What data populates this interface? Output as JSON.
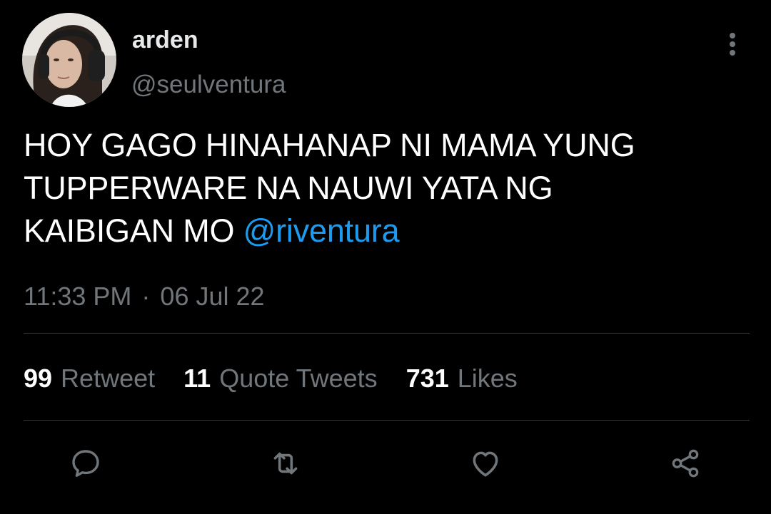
{
  "user": {
    "display_name": "arden",
    "handle": "@seulventura"
  },
  "tweet": {
    "line1": "HOY GAGO HINAHANAP NI MAMA YUNG",
    "line2": "TUPPERWARE NA NAUWI YATA NG",
    "line3_prefix": "KAIBIGAN MO ",
    "mention": "@riventura",
    "time": "11:33 PM",
    "separator": "·",
    "date": "06 Jul 22"
  },
  "stats": {
    "retweet_count": "99",
    "retweet_label": "Retweet",
    "quote_count": "11",
    "quote_label": "Quote Tweets",
    "like_count": "731",
    "like_label": "Likes"
  },
  "icons": {
    "more": "more-vertical-icon",
    "reply": "reply-icon",
    "retweet": "retweet-icon",
    "like": "heart-icon",
    "share": "share-icon"
  },
  "colors": {
    "background": "#000000",
    "text": "#ffffff",
    "secondary": "#71767b",
    "link": "#1d9bf0",
    "divider": "#2f3336"
  }
}
